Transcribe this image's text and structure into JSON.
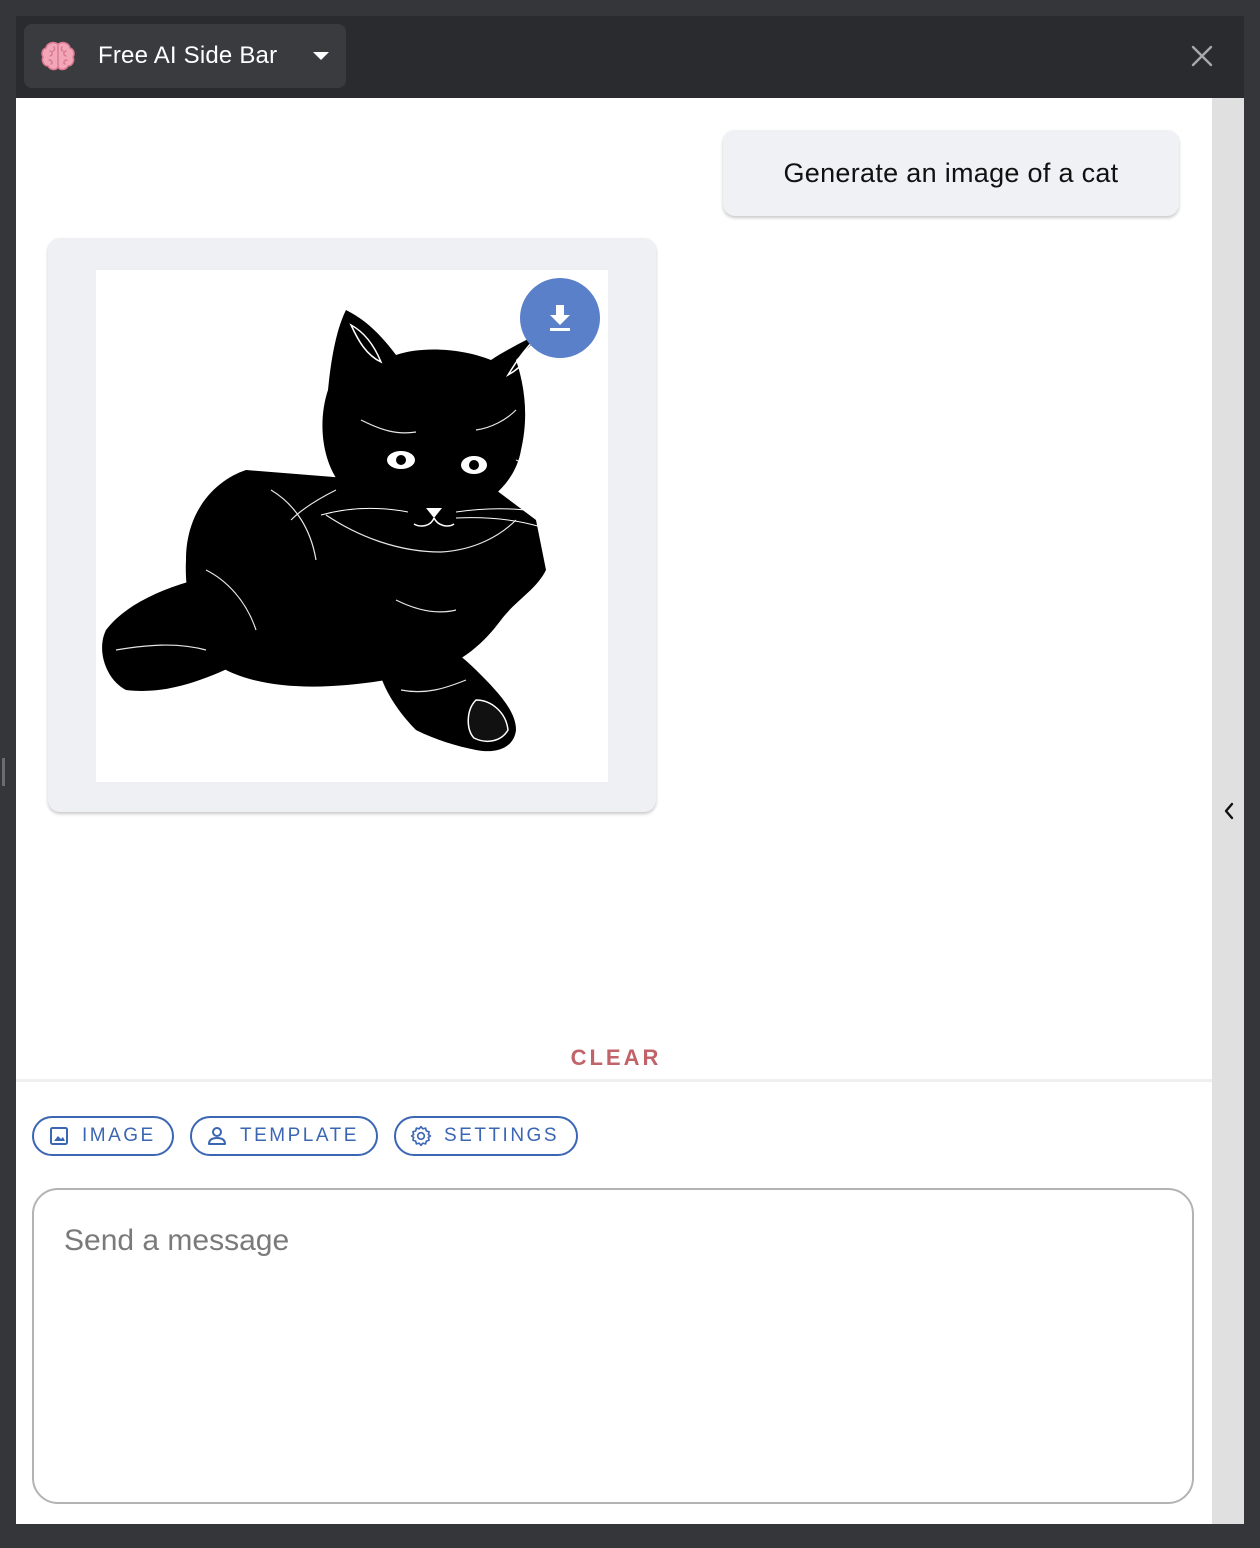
{
  "header": {
    "title": "Free AI Side Bar",
    "brain_icon": "brain-icon",
    "dropdown_icon": "caret-down-icon",
    "close_icon": "close-icon"
  },
  "conversation": {
    "user_message": "Generate an image of a cat",
    "generated_image": {
      "subject": "cat",
      "download_icon": "download-icon"
    }
  },
  "actions": {
    "clear_label": "CLEAR"
  },
  "toolbar": {
    "chips": [
      {
        "label": "IMAGE",
        "icon": "image-icon"
      },
      {
        "label": "TEMPLATE",
        "icon": "person-icon"
      },
      {
        "label": "SETTINGS",
        "icon": "gear-icon"
      }
    ]
  },
  "composer": {
    "placeholder": "Send a message",
    "value": ""
  },
  "side_rail": {
    "chevron_icon": "chevron-left-icon"
  },
  "colors": {
    "titlebar": "#2a2b2f",
    "accent": "#3a66b3",
    "download_button": "#5a80c9",
    "clear": "#c0646a",
    "bubble": "#f0f1f4"
  }
}
